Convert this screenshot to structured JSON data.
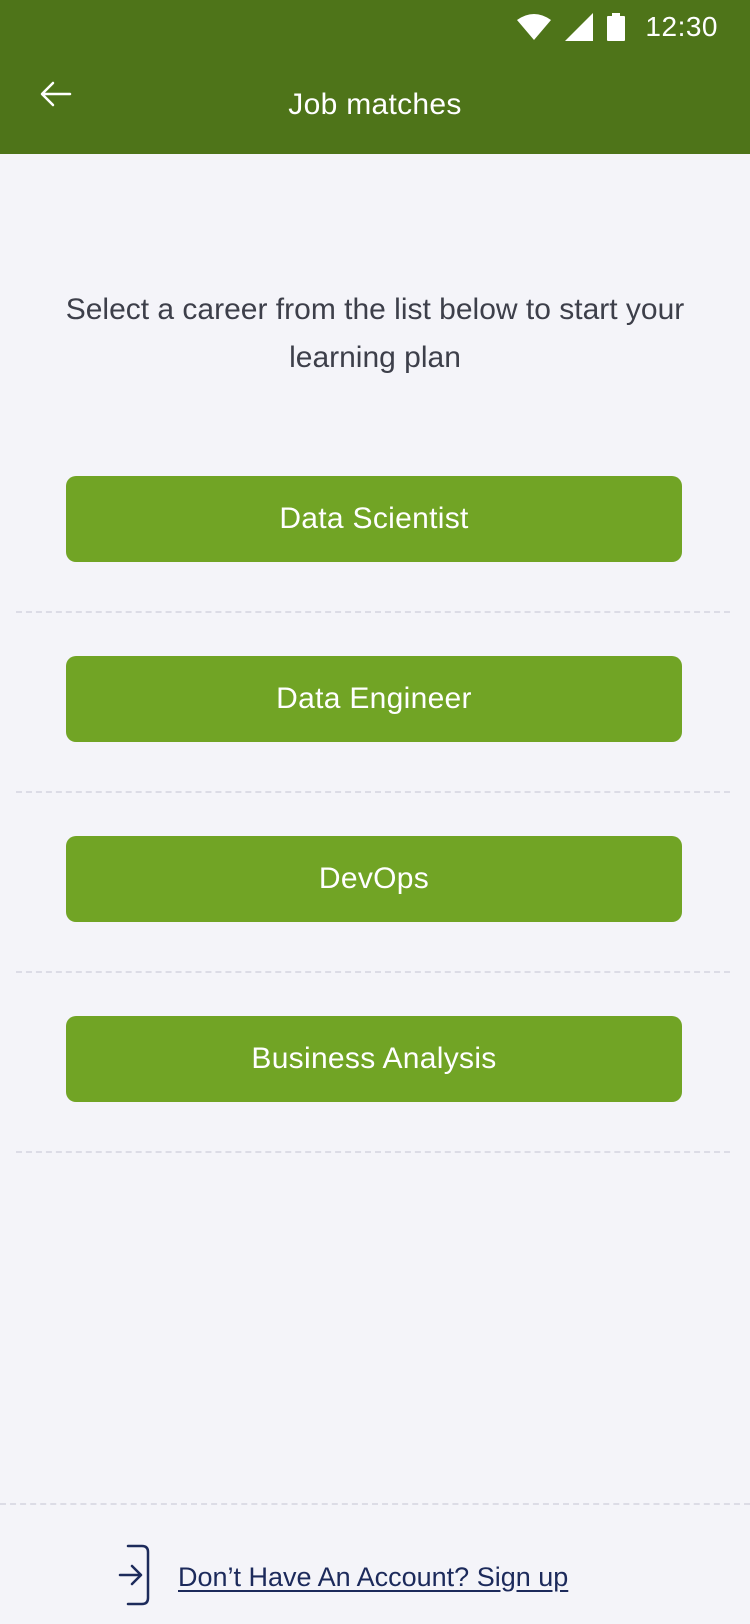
{
  "status_bar": {
    "time": "12:30",
    "icons": [
      "wifi-icon",
      "cellular-signal-icon",
      "battery-icon"
    ]
  },
  "header": {
    "title": "Job matches",
    "back_icon": "arrow-left-icon"
  },
  "intro": {
    "text": "Select a career from the list below to start your learning plan"
  },
  "careers": [
    {
      "label": "Data Scientist"
    },
    {
      "label": "Data Engineer"
    },
    {
      "label": "DevOps"
    },
    {
      "label": "Business Analysis"
    }
  ],
  "footer": {
    "icon": "sign-in-icon",
    "signup_text": "Don’t Have An Account? Sign up"
  },
  "colors": {
    "header": "#4e7419",
    "button": "#71a425",
    "background": "#f4f4f9",
    "link": "#1c2a5b"
  }
}
